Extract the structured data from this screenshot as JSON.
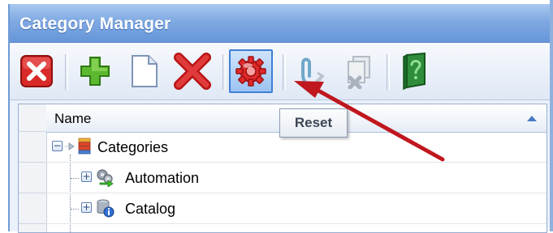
{
  "window": {
    "title": "Category Manager"
  },
  "toolbar": {
    "buttons": [
      {
        "name": "close",
        "icon": "close-square-icon",
        "state": "enabled"
      },
      {
        "name": "add",
        "icon": "plus-icon",
        "state": "enabled"
      },
      {
        "name": "new-document",
        "icon": "blank-document-icon",
        "state": "enabled"
      },
      {
        "name": "delete",
        "icon": "delete-x-icon",
        "state": "enabled"
      },
      {
        "name": "reset",
        "icon": "reset-gear-icon",
        "state": "hovered"
      },
      {
        "name": "attach",
        "icon": "paperclip-icon",
        "state": "disabled"
      },
      {
        "name": "remove-files",
        "icon": "remove-files-icon",
        "state": "disabled"
      },
      {
        "name": "help",
        "icon": "help-book-icon",
        "state": "enabled"
      }
    ],
    "tooltip": "Reset"
  },
  "grid": {
    "column_header": "Name",
    "sort": "ascending",
    "rows": [
      {
        "label": "Categories",
        "icon": "category-list-icon",
        "expander": "−",
        "level": 0
      },
      {
        "label": "Automation",
        "icon": "automation-gears-icon",
        "expander": "+",
        "level": 1
      },
      {
        "label": "Catalog",
        "icon": "catalog-info-icon",
        "expander": "+",
        "level": 1
      }
    ]
  },
  "colors": {
    "title_bar": "#7fa9e2",
    "accent_red": "#d62424",
    "accent_green": "#5cb82e",
    "annotation_arrow": "#c0171f"
  }
}
